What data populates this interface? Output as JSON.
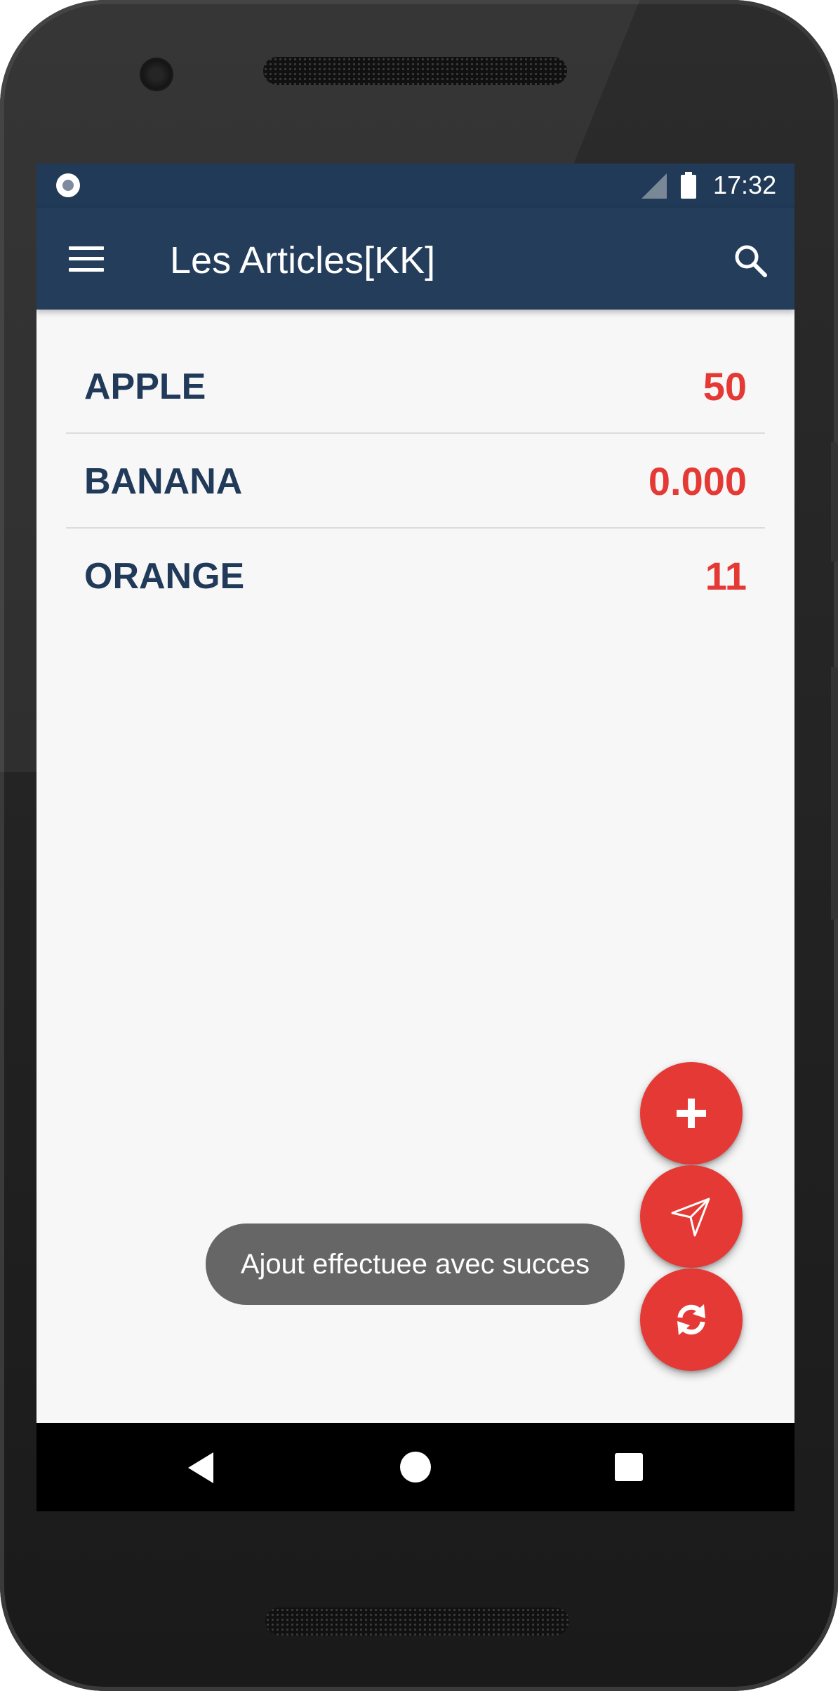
{
  "statusbar": {
    "time": "17:32",
    "icons": [
      "notification-dot-icon",
      "signal-icon",
      "battery-icon"
    ]
  },
  "toolbar": {
    "title": "Les Articles[KK]",
    "menu_icon": "hamburger-menu-icon",
    "search_icon": "search-icon",
    "color": "#233d5b"
  },
  "articles": [
    {
      "name": "APPLE",
      "value": "50"
    },
    {
      "name": "BANANA",
      "value": "0.000"
    },
    {
      "name": "ORANGE",
      "value": "11"
    }
  ],
  "fabs": [
    {
      "icon": "plus-icon",
      "action": "add"
    },
    {
      "icon": "send-icon",
      "action": "send"
    },
    {
      "icon": "sync-icon",
      "action": "sync"
    }
  ],
  "toast": {
    "message": "Ajout effectuee avec succes"
  },
  "navbar": {
    "icons": [
      "back-icon",
      "home-icon",
      "recents-icon"
    ]
  },
  "colors": {
    "primary": "#233d5b",
    "accent": "#e53935",
    "item_name": "#213a59",
    "background": "#f7f7f7"
  }
}
